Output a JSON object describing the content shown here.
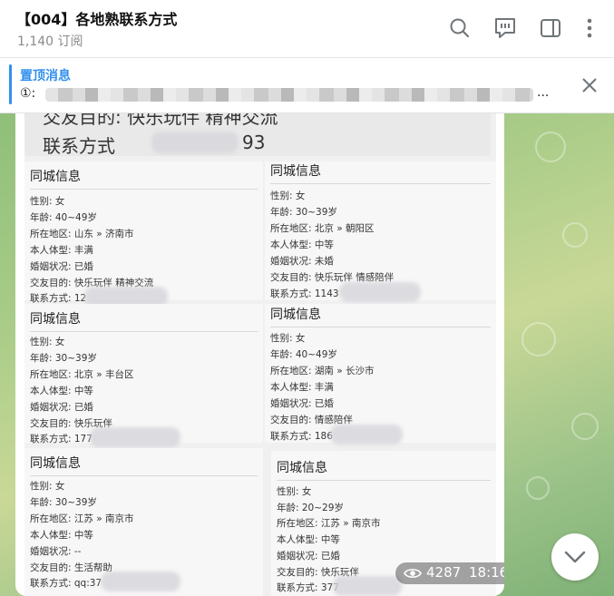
{
  "header": {
    "title": "【004】各地熟联系方式",
    "subscribers": "1,140 订阅"
  },
  "pinned": {
    "title": "置顶消息",
    "prefix": "①:",
    "ellipsis": "..."
  },
  "message": {
    "top_card": {
      "line1": "交友目的: 快乐玩伴 精神交流",
      "line2_label": "联系方式",
      "line2_suffix": "93"
    },
    "cards": [
      {
        "title": "同城信息",
        "gender": "性别: 女",
        "age": "年龄: 40~49岁",
        "region": "所在地区: 山东 » 济南市",
        "body": "本人体型: 丰满",
        "marital": "婚姻状况: 已婚",
        "purpose": "交友目的: 快乐玩伴 精神交流",
        "contact": "联系方式: 12"
      },
      {
        "title": "同城信息",
        "gender": "性别: 女",
        "age": "年龄: 30~39岁",
        "region": "所在地区: 北京 » 朝阳区",
        "body": "本人体型: 中等",
        "marital": "婚姻状况: 未婚",
        "purpose": "交友目的: 快乐玩伴 情感陪伴",
        "contact": "联系方式: 1143"
      },
      {
        "title": "同城信息",
        "gender": "性别: 女",
        "age": "年龄: 30~39岁",
        "region": "所在地区: 北京 » 丰台区",
        "body": "本人体型: 中等",
        "marital": "婚姻状况: 已婚",
        "purpose": "交友目的: 快乐玩伴",
        "contact": "联系方式: 177"
      },
      {
        "title": "同城信息",
        "gender": "性别: 女",
        "age": "年龄: 40~49岁",
        "region": "所在地区: 湖南 » 长沙市",
        "body": "本人体型: 丰满",
        "marital": "婚姻状况: 已婚",
        "purpose": "交友目的: 情感陪伴",
        "contact": "联系方式: 186"
      },
      {
        "title": "同城信息",
        "gender": "性别: 女",
        "age": "年龄: 30~39岁",
        "region": "所在地区: 江苏 » 南京市",
        "body": "本人体型: 中等",
        "marital": "婚姻状况: --",
        "purpose": "交友目的: 生活帮助",
        "contact": "联系方式: qq:37"
      },
      {
        "title": "同城信息",
        "gender": "性别: 女",
        "age": "年龄: 20~29岁",
        "region": "所在地区: 江苏 » 南京市",
        "body": "本人体型: 中等",
        "marital": "婚姻状况: 已婚",
        "purpose": "交友目的: 快乐玩伴",
        "contact": "联系方式: 377"
      }
    ],
    "views": "4287",
    "time": "18:16"
  },
  "icons": {
    "search": "search-icon",
    "comments": "comments-icon",
    "sidebar": "sidebar-toggle-icon",
    "more": "more-vertical-icon",
    "close": "close-icon",
    "views": "eye-icon",
    "scroll_down": "chevron-down-icon"
  },
  "colors": {
    "accent": "#3390ec",
    "header_text": "#111111",
    "subtle_text": "#8a8a8a"
  }
}
